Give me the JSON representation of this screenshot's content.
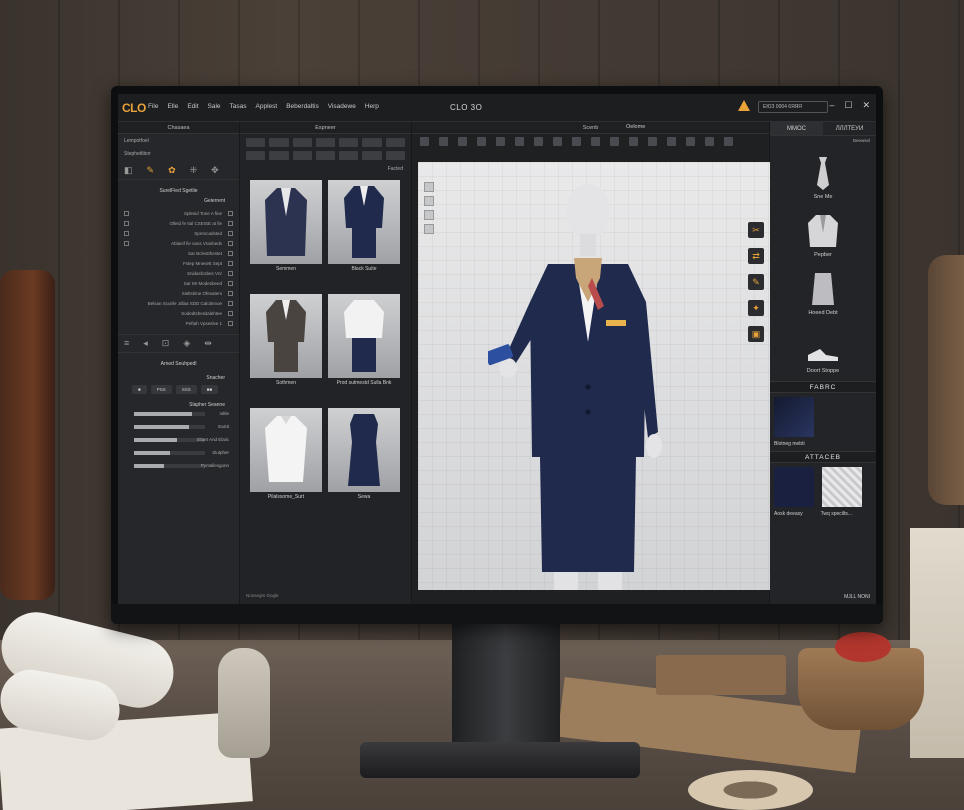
{
  "app": {
    "logo": "CLO",
    "title": "CLO 3O",
    "license": "ЕЮЗ 0004 6ЯЯЯ",
    "menu": [
      "File",
      "Elle",
      "Edit",
      "Sale",
      "Tasas",
      "Applest",
      "Beberdaltis",
      "Visadewe",
      "Herp"
    ]
  },
  "left_panel": {
    "header": "Chasaea",
    "rows": [
      "Lempotfoel",
      "Stephetlibor"
    ],
    "section_label": "SurelFied Sgetlie",
    "tree_header": "Geierrent",
    "tree": [
      "Splesid Tone A fine",
      "Olleid fe Ital CSEISE at fie",
      "Sprencadsted",
      "Ablaeif fie vans Vranbeds",
      "Sar Bclestthestet",
      "Fstep Mnesett Sept",
      "Snidasfcsbes Vnr",
      "Sar Mr Modesbeed",
      "Sieltstime Ofesaters",
      "Belsan Scuirle Jdlaa SDD Calotinnoe",
      "Sodedtshesitalehtee",
      "Peftah Vpseslve  1"
    ],
    "section2": "Arned Seuhpedl",
    "section2_sub": "Snacher",
    "seg": [
      "■",
      "PSS",
      "SSS",
      "■■"
    ],
    "sub3": "Slapher Seanne",
    "sliders": [
      {
        "label": "Ioltle",
        "fill": 0.82
      },
      {
        "label": "EaSit",
        "fill": 0.78
      },
      {
        "label": "Sltaet And Elaiic",
        "fill": 0.6
      },
      {
        "label": "Slutpher",
        "fill": 0.5
      },
      {
        "label": "Pyntallesgonn",
        "fill": 0.42
      }
    ]
  },
  "explorer": {
    "header": "Espneer",
    "filter": "Facted",
    "items": [
      "Semmen",
      "Black Suite",
      "Sothmen",
      "Prod sutmestd Sulla Bnk",
      "Pilalssome_Surt",
      "Sewa"
    ],
    "footer": "Nonsegm Gogle"
  },
  "viewport": {
    "header": "Scenb",
    "label": "Oelome"
  },
  "right_panel": {
    "tabs": [
      "MMOC",
      "ЛЛЛТЕУИ"
    ],
    "sort": "Beewsel",
    "items": [
      "Sne Me",
      "Pepber",
      "Hoeed Debt",
      "Doort Stoppe"
    ],
    "fabric_header": "FABRC",
    "fabric_items": [
      "Blotneg mebti"
    ],
    "attach_header": "ATTACEB",
    "attach_items": [
      "Aosk deeasy",
      "Twq specilts..."
    ],
    "footer": "MJLL NONI"
  },
  "colors": {
    "accent": "#e8a23a",
    "navy": "#1f2a4d"
  }
}
